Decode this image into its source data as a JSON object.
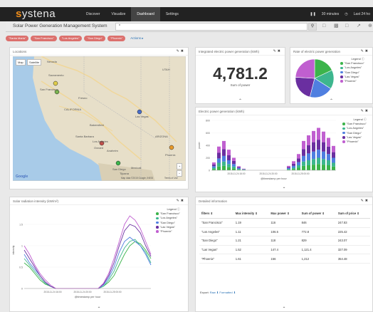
{
  "nav": {
    "logo_prefix": "s",
    "logo_rest": "ystena",
    "items": [
      {
        "label": "Discover"
      },
      {
        "label": "Visualize"
      },
      {
        "label": "Dashboard"
      },
      {
        "label": "Settings"
      }
    ],
    "timerange": "30 minutes",
    "last_label": "Last 24 ho"
  },
  "toolbar": {
    "dashboard_title": "Solar Power Generation Management System",
    "query_value": "*",
    "search_icon": "magnifier-icon"
  },
  "filters": {
    "pills": [
      "\"Santa Maria\"",
      "\"San Francisco\"",
      "\"Los Angeles\"",
      "\"San Diego\"",
      "\"Phoenix\""
    ],
    "actions_label": "Actions ▸"
  },
  "locations": {
    "title": "Locations",
    "map_type": "Map",
    "satellite": "Satellite",
    "google": "Google",
    "map_data": "Map data ©2015 Google, INEGI",
    "terms": "Terms of Use",
    "places": [
      "Sacramento",
      "San Francisco",
      "Fresno",
      "CALIFORNIA",
      "Las Vegas",
      "Los Angeles",
      "San Diego",
      "Tijuana",
      "Phoenix",
      "UTAH",
      "ARIZONA",
      "Nevada",
      "Mexicali",
      "Bakersfield",
      "Santa Barbara",
      "Oxnard",
      "Anaheim"
    ]
  },
  "integrated": {
    "title": "Integrated electric power generation (kWh)",
    "value": "4,781.2",
    "sublabel": "Sum of power"
  },
  "rate": {
    "title": "Rate of electric power generation",
    "legend_title": "Legend ⓘ",
    "legend": [
      {
        "name": "\"San Francisco\"",
        "color": "#3cb44b"
      },
      {
        "name": "\"Los Angeles\"",
        "color": "#3db68e"
      },
      {
        "name": "\"San Diego\"",
        "color": "#4f7fe0"
      },
      {
        "name": "\"Las Vegas\"",
        "color": "#6a2fa0"
      },
      {
        "name": "\"Phoenix\"",
        "color": "#c05fd0"
      }
    ],
    "chart_data": {
      "type": "pie",
      "categories": [
        "San Francisco",
        "Los Angeles",
        "San Diego",
        "Las Vegas",
        "Phoenix"
      ],
      "values": [
        18,
        16,
        20,
        22,
        24
      ]
    }
  },
  "electric": {
    "title": "Electric power generation (kWh)",
    "ylabel": "power",
    "xlabel": "@timestamp per hour",
    "yticks": [
      "800",
      "600",
      "400",
      "200",
      "0"
    ],
    "xticks": [
      "2015-11-24 16:00",
      "2015-11-24 20:00",
      "2015-11-25 00:00"
    ],
    "legend_title": "Legend ⓘ",
    "legend": [
      {
        "name": "\"San Francisco\"",
        "color": "#3cb44b"
      },
      {
        "name": "\"Los Angeles\"",
        "color": "#3db68e"
      },
      {
        "name": "\"San Diego\"",
        "color": "#4f7fe0"
      },
      {
        "name": "\"Las Vegas\"",
        "color": "#6a2fa0"
      },
      {
        "name": "\"Phoenix\"",
        "color": "#c05fd0"
      }
    ],
    "chart_data": {
      "type": "bar",
      "stacked": true,
      "categories": [
        "b1",
        "b2",
        "b3",
        "b4",
        "b5",
        "b6",
        "b7",
        "b8",
        "b9",
        "b10",
        "b11",
        "b12",
        "b13",
        "b14",
        "b15",
        "b16",
        "b17",
        "b18",
        "b19",
        "b20",
        "b21",
        "b22",
        "b23",
        "b24",
        "b25"
      ],
      "series": [
        {
          "name": "\"San Francisco\"",
          "values": [
            20,
            60,
            70,
            50,
            30,
            10,
            5,
            0,
            0,
            0,
            0,
            0,
            0,
            0,
            0,
            10,
            20,
            40,
            70,
            80,
            90,
            100,
            90,
            80,
            60
          ]
        },
        {
          "name": "\"Los Angeles\"",
          "values": [
            20,
            60,
            70,
            50,
            30,
            10,
            5,
            0,
            0,
            0,
            0,
            0,
            0,
            0,
            0,
            10,
            20,
            40,
            70,
            80,
            90,
            100,
            90,
            80,
            60
          ]
        },
        {
          "name": "\"San Diego\"",
          "values": [
            25,
            70,
            90,
            60,
            40,
            15,
            5,
            0,
            0,
            0,
            0,
            0,
            0,
            0,
            0,
            15,
            30,
            50,
            90,
            110,
            120,
            130,
            120,
            100,
            80
          ]
        },
        {
          "name": "\"Las Vegas\"",
          "values": [
            30,
            90,
            110,
            80,
            50,
            15,
            5,
            0,
            0,
            0,
            0,
            0,
            0,
            0,
            0,
            15,
            35,
            60,
            110,
            130,
            150,
            160,
            150,
            120,
            90
          ]
        },
        {
          "name": "\"Phoenix\"",
          "values": [
            30,
            100,
            130,
            90,
            50,
            15,
            5,
            0,
            0,
            0,
            0,
            0,
            0,
            0,
            0,
            20,
            40,
            70,
            130,
            160,
            180,
            190,
            170,
            140,
            100
          ]
        }
      ],
      "ylim": [
        0,
        800
      ]
    }
  },
  "radiation": {
    "title": "Solar radiation intensity (kW/m²)",
    "ylabel": "intensity",
    "xlabel": "@timestamp per hour",
    "yticks": [
      "1.5",
      "1",
      "0.5",
      "0"
    ],
    "xticks": [
      "2015-11-24 16:00",
      "2015-11-24 20:00",
      "2015-11-25 00:00"
    ],
    "legend_title": "Legend ⓘ",
    "legend": [
      {
        "name": "\"San Francisco\"",
        "color": "#3cb44b"
      },
      {
        "name": "\"Los Angeles\"",
        "color": "#3db68e"
      },
      {
        "name": "\"San Diego\"",
        "color": "#4f7fe0"
      },
      {
        "name": "\"Las Vegas\"",
        "color": "#6a2fa0"
      },
      {
        "name": "\"Phoenix\"",
        "color": "#c05fd0"
      }
    ],
    "chart_data": {
      "type": "line",
      "x": [
        0,
        1,
        2,
        3,
        4,
        5,
        6,
        7,
        8,
        9,
        10,
        11,
        12,
        13,
        14,
        15,
        16,
        17,
        18,
        19,
        20,
        21,
        22,
        23,
        24
      ],
      "series": [
        {
          "name": "\"San Francisco\"",
          "values": [
            0.6,
            0.5,
            0.35,
            0.2,
            0.1,
            0.05,
            0,
            0,
            0,
            0,
            0,
            0,
            0,
            0,
            0,
            0.05,
            0.15,
            0.3,
            0.55,
            0.8,
            1.0,
            1.1,
            1.05,
            0.9,
            0.7
          ]
        },
        {
          "name": "\"Los Angeles\"",
          "values": [
            0.7,
            0.55,
            0.4,
            0.25,
            0.12,
            0.05,
            0,
            0,
            0,
            0,
            0,
            0,
            0,
            0,
            0,
            0.05,
            0.2,
            0.4,
            0.7,
            0.95,
            1.1,
            1.15,
            1.0,
            0.85,
            0.6
          ]
        },
        {
          "name": "\"San Diego\"",
          "values": [
            0.8,
            0.6,
            0.45,
            0.3,
            0.15,
            0.05,
            0,
            0,
            0,
            0,
            0,
            0,
            0,
            0,
            0,
            0.08,
            0.25,
            0.5,
            0.85,
            1.1,
            1.2,
            1.1,
            1.0,
            0.8,
            0.55
          ]
        },
        {
          "name": "\"Las Vegas\"",
          "values": [
            0.9,
            0.7,
            0.5,
            0.3,
            0.15,
            0.05,
            0,
            0,
            0,
            0,
            0,
            0,
            0,
            0,
            0,
            0.1,
            0.3,
            0.6,
            1.0,
            1.35,
            1.5,
            1.45,
            1.3,
            1.0,
            0.75
          ]
        },
        {
          "name": "\"Phoenix\"",
          "values": [
            1.0,
            0.8,
            0.55,
            0.35,
            0.2,
            0.08,
            0,
            0,
            0,
            0,
            0,
            0,
            0,
            0,
            0,
            0.12,
            0.35,
            0.7,
            1.1,
            1.5,
            1.7,
            1.6,
            1.4,
            1.1,
            0.8
          ]
        }
      ],
      "ylim": [
        0,
        1.8
      ]
    }
  },
  "detailed": {
    "title": "Detailed information",
    "columns": [
      "filters ⇕",
      "Max intensity ⇕",
      "Max power ⇕",
      "Sum of power ⇕",
      "Sum of price ⇕"
    ],
    "rows": [
      [
        "\"San Francisco\"",
        "1.19",
        "116",
        "846",
        "247.83"
      ],
      [
        "\"Los Angeles\"",
        "1.11",
        "106.5",
        "772.8",
        "225.42"
      ],
      [
        "\"San Diego\"",
        "1.21",
        "118",
        "829",
        "243.07"
      ],
      [
        "\"Las Vegas\"",
        "1.52",
        "147.4",
        "1,121.4",
        "327.09"
      ],
      [
        "\"Phoenix\"",
        "1.61",
        "156",
        "1,212",
        "354.48"
      ]
    ],
    "export_label": "Export:",
    "export_raw": "Raw ⬇",
    "export_formatted": "Formatted ⬇"
  }
}
